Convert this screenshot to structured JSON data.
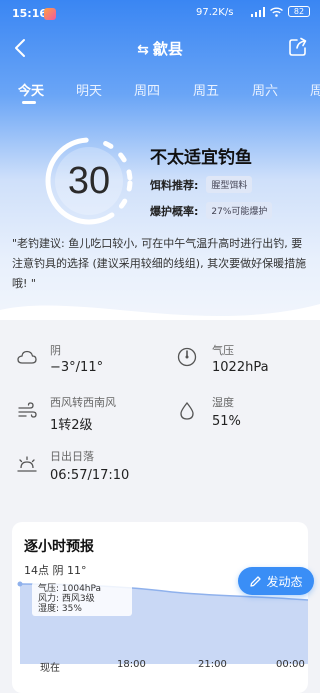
{
  "status_bar": {
    "time": "15:16",
    "speed": "97.2K/s",
    "battery": "82"
  },
  "nav": {
    "swap_glyph": "⇆",
    "city": "歙县"
  },
  "tabs": [
    "今天",
    "明天",
    "周四",
    "周五",
    "周六",
    "周"
  ],
  "score": {
    "value": "30",
    "verdict": "不太适宜钓鱼"
  },
  "bait": {
    "label": "饵料推荐:",
    "value": "腥型饵料"
  },
  "explode": {
    "label": "爆护概率:",
    "value": "27%可能爆护"
  },
  "advice": "\"老钓建议: 鱼儿吃口较小, 可在中午气温升高时进行出钓, 要注意钓具的选择 (建议采用较细的线组), 其次要做好保暖措施哦! \"",
  "details": {
    "weather": {
      "label": "阴",
      "value": "−3°/11°",
      "icon": "cloud-icon"
    },
    "pressure": {
      "label": "气压",
      "value": "1022hPa",
      "icon": "gauge-icon"
    },
    "wind": {
      "label": "西风转西南风",
      "value": "1转2级",
      "icon": "wind-icon"
    },
    "humidity": {
      "label": "湿度",
      "value": "51%",
      "icon": "droplet-icon"
    },
    "sun": {
      "label": "日出日落",
      "value": "06:57/17:10",
      "icon": "sunrise-icon"
    }
  },
  "hourly": {
    "title": "逐小时预报",
    "current": "14点 阴 11°",
    "tooltip": {
      "pressure": "气压: 1004hPa",
      "wind": "风力: 西风3级",
      "humidity": "湿度: 35%"
    },
    "fab_label": "发动态",
    "x_labels": [
      "现在",
      "18:00",
      "21:00",
      "00:00"
    ],
    "colors": {
      "area": "#c9d8f5",
      "line": "#8fb1ec"
    }
  }
}
